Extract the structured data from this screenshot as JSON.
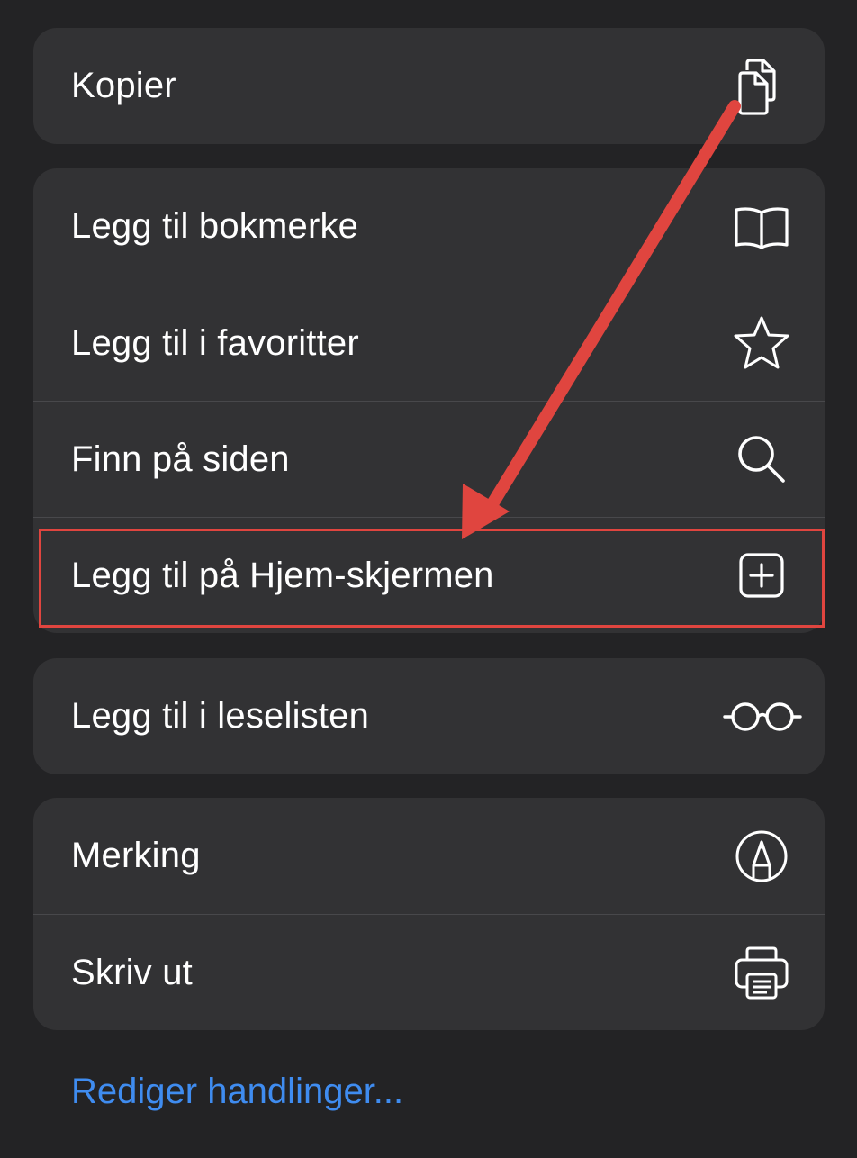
{
  "groups": [
    {
      "items": [
        {
          "label": "Kopier",
          "icon": "copy-icon"
        }
      ]
    },
    {
      "items": [
        {
          "label": "Legg til bokmerke",
          "icon": "book-icon"
        },
        {
          "label": "Legg til i favoritter",
          "icon": "star-icon"
        },
        {
          "label": "Finn på siden",
          "icon": "search-icon"
        },
        {
          "label": "Legg til på Hjem-skjermen",
          "icon": "add-square-icon"
        }
      ]
    },
    {
      "items": [
        {
          "label": "Legg til i leselisten",
          "icon": "glasses-icon"
        }
      ]
    },
    {
      "items": [
        {
          "label": "Merking",
          "icon": "markup-icon"
        },
        {
          "label": "Skriv ut",
          "icon": "printer-icon"
        }
      ]
    }
  ],
  "edit_actions_label": "Rediger handlinger...",
  "colors": {
    "background": "#232325",
    "group_background": "#323234",
    "link": "#3f8cf0",
    "annotation": "#e0453f"
  }
}
